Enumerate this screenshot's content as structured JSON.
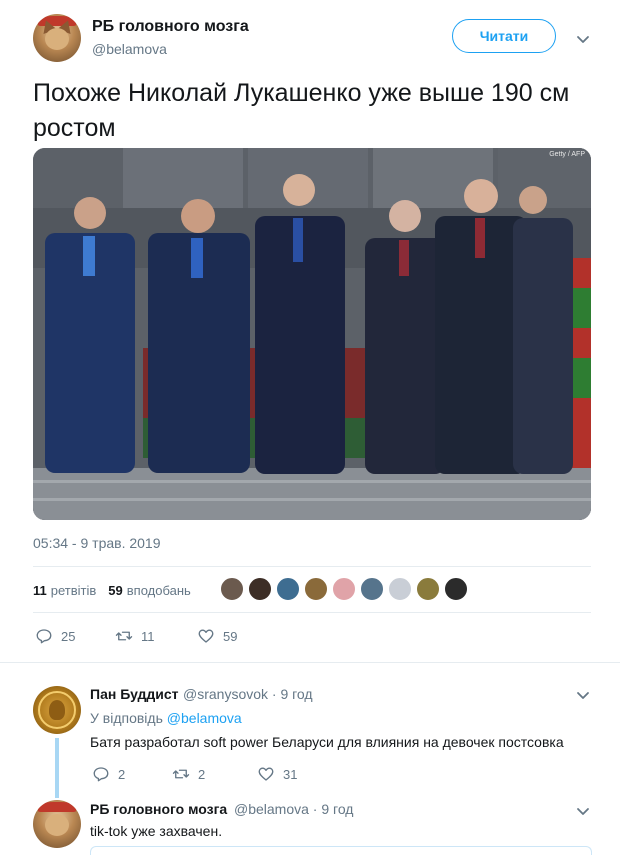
{
  "tweet": {
    "author_name": "РБ головного мозга",
    "author_handle": "@belamova",
    "follow_label": "Читати",
    "text": "Похоже Николай Лукашенко уже выше 190 см ростом",
    "timestamp": "05:34 - 9 трав. 2019",
    "retweets_count": "11",
    "retweets_label": "ретвітів",
    "likes_count": "59",
    "likes_label": "вподобань",
    "reply_count": "25",
    "retweet_action_count": "11",
    "like_action_count": "59",
    "photo_credit": "Getty / AFP"
  },
  "likers_colors": [
    "#6b5a4e",
    "#3d2e26",
    "#3e6d91",
    "#8a6a3a",
    "#e0a3a8",
    "#56748c",
    "#c9ced6",
    "#8a7b3c",
    "#2b2b2b"
  ],
  "replies": [
    {
      "author_name": "Пан Буддист",
      "meta": "@sranysovok · 9 год",
      "reply_to_prefix": "У відповідь",
      "reply_to_mention": "@belamova",
      "text": "Батя разработал soft power Беларуси для влияния на девочек постсовка",
      "reply_count": "2",
      "retweet_count": "2",
      "like_count": "31"
    },
    {
      "author_name": "РБ головного мозга",
      "meta": "@belamova · 9 год",
      "text": "tik-tok уже захвачен."
    }
  ],
  "colors": {
    "accent": "#1da1f2",
    "secondary_text": "#657786",
    "primary_text": "#14171a",
    "thread_line": "#a8d7f4"
  },
  "icons": {
    "reply": "reply-icon",
    "retweet": "retweet-icon",
    "like": "heart-icon",
    "menu": "chevron-down-icon"
  }
}
